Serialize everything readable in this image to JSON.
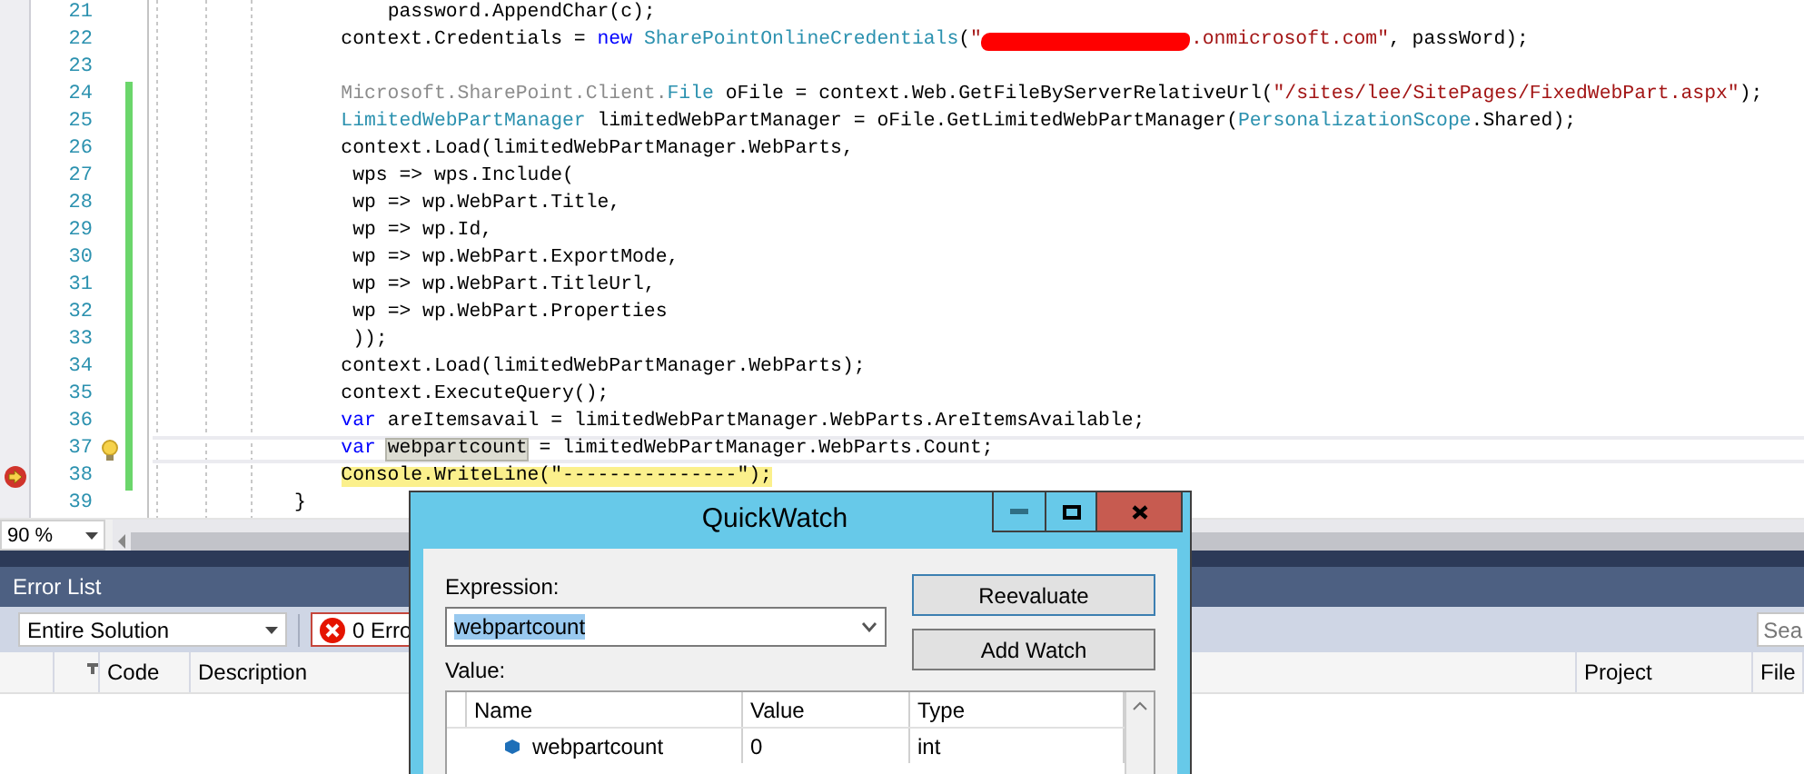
{
  "editor": {
    "lines": [
      {
        "number": "21",
        "changed": false,
        "caret_line": false,
        "lightbulb": false,
        "execution_point": false,
        "tokens": [
          {
            "kind": "plain",
            "text": "        password.AppendChar(c);"
          }
        ]
      },
      {
        "number": "22",
        "changed": false,
        "caret_line": false,
        "lightbulb": false,
        "execution_point": false,
        "tokens": [
          {
            "kind": "plain",
            "text": "    context.Credentials = "
          },
          {
            "kind": "keyword",
            "text": "new"
          },
          {
            "kind": "type",
            "text": " SharePointOnlineCredentials"
          },
          {
            "kind": "plain",
            "text": "("
          },
          {
            "kind": "string",
            "text": "\""
          },
          {
            "kind": "redaction"
          },
          {
            "kind": "string",
            "text": ".onmicrosoft.com\""
          },
          {
            "kind": "plain",
            "text": ", passWord);"
          }
        ]
      },
      {
        "number": "23",
        "changed": false,
        "caret_line": false,
        "lightbulb": false,
        "execution_point": false
      },
      {
        "number": "24",
        "changed": true,
        "caret_line": false,
        "lightbulb": false,
        "execution_point": false,
        "tokens": [
          {
            "kind": "namespace",
            "text": "    Microsoft.SharePoint.Client."
          },
          {
            "kind": "type",
            "text": "File"
          },
          {
            "kind": "plain",
            "text": " oFile = context.Web.GetFileByServerRelativeUrl("
          },
          {
            "kind": "string",
            "text": "\"/sites/lee/SitePages/FixedWebPart.aspx\""
          },
          {
            "kind": "plain",
            "text": ");"
          }
        ]
      },
      {
        "number": "25",
        "changed": true,
        "caret_line": false,
        "lightbulb": false,
        "execution_point": false,
        "tokens": [
          {
            "kind": "type",
            "text": "    LimitedWebPartManager"
          },
          {
            "kind": "plain",
            "text": " limitedWebPartManager = oFile.GetLimitedWebPartManager("
          },
          {
            "kind": "type",
            "text": "PersonalizationScope"
          },
          {
            "kind": "plain",
            "text": ".Shared);"
          }
        ]
      },
      {
        "number": "26",
        "changed": true,
        "caret_line": false,
        "lightbulb": false,
        "execution_point": false,
        "tokens": [
          {
            "kind": "plain",
            "text": "    context.Load(limitedWebPartManager.WebParts,"
          }
        ]
      },
      {
        "number": "27",
        "changed": true,
        "caret_line": false,
        "lightbulb": false,
        "execution_point": false,
        "tokens": [
          {
            "kind": "plain",
            "text": "     wps => wps.Include("
          }
        ]
      },
      {
        "number": "28",
        "changed": true,
        "caret_line": false,
        "lightbulb": false,
        "execution_point": false,
        "tokens": [
          {
            "kind": "plain",
            "text": "     wp => wp.WebPart.Title,"
          }
        ]
      },
      {
        "number": "29",
        "changed": true,
        "caret_line": false,
        "lightbulb": false,
        "execution_point": false,
        "tokens": [
          {
            "kind": "plain",
            "text": "     wp => wp.Id,"
          }
        ]
      },
      {
        "number": "30",
        "changed": true,
        "caret_line": false,
        "lightbulb": false,
        "execution_point": false,
        "tokens": [
          {
            "kind": "plain",
            "text": "     wp => wp.WebPart.ExportMode,"
          }
        ]
      },
      {
        "number": "31",
        "changed": true,
        "caret_line": false,
        "lightbulb": false,
        "execution_point": false,
        "tokens": [
          {
            "kind": "plain",
            "text": "     wp => wp.WebPart.TitleUrl,"
          }
        ]
      },
      {
        "number": "32",
        "changed": true,
        "caret_line": false,
        "lightbulb": false,
        "execution_point": false,
        "tokens": [
          {
            "kind": "plain",
            "text": "     wp => wp.WebPart.Properties"
          }
        ]
      },
      {
        "number": "33",
        "changed": true,
        "caret_line": false,
        "lightbulb": false,
        "execution_point": false,
        "tokens": [
          {
            "kind": "plain",
            "text": "     ));"
          }
        ]
      },
      {
        "number": "34",
        "changed": true,
        "caret_line": false,
        "lightbulb": false,
        "execution_point": false,
        "tokens": [
          {
            "kind": "plain",
            "text": "    context.Load(limitedWebPartManager.WebParts);"
          }
        ]
      },
      {
        "number": "35",
        "changed": true,
        "caret_line": false,
        "lightbulb": false,
        "execution_point": false,
        "tokens": [
          {
            "kind": "plain",
            "text": "    context.ExecuteQuery();"
          }
        ]
      },
      {
        "number": "36",
        "changed": true,
        "caret_line": false,
        "lightbulb": false,
        "execution_point": false,
        "tokens": [
          {
            "kind": "keyword",
            "text": "    var"
          },
          {
            "kind": "plain",
            "text": " areItemsavail = limitedWebPartManager.WebParts.AreItemsAvailable;"
          }
        ]
      },
      {
        "number": "37",
        "changed": true,
        "caret_line": true,
        "lightbulb": true,
        "execution_point": false,
        "tokens": [
          {
            "kind": "keyword",
            "text": "    var"
          },
          {
            "kind": "match",
            "text": " webpartcount"
          },
          {
            "kind": "plain",
            "text": " = limitedWebPartManager.WebParts.Count;"
          }
        ]
      },
      {
        "number": "38",
        "changed": true,
        "caret_line": false,
        "lightbulb": false,
        "execution_point": true,
        "tokens": [
          {
            "kind": "current",
            "text": "    Console.WriteLine(\"---------------\");"
          }
        ]
      },
      {
        "number": "39",
        "changed": false,
        "caret_line": false,
        "lightbulb": false,
        "execution_point": false,
        "tokens": [
          {
            "kind": "plain",
            "text": "}"
          }
        ]
      }
    ],
    "zoom": "90 %"
  },
  "error_list": {
    "title": "Error List",
    "scope": "Entire Solution",
    "errors_button": "0 Erro",
    "search": "Sea",
    "columns": [
      "Code",
      "Description",
      "Project",
      "File"
    ]
  },
  "quickwatch": {
    "title": "QuickWatch",
    "expression_label": "Expression:",
    "expression": "webpartcount",
    "value_label": "Value:",
    "buttons": [
      "Reevaluate",
      "Add Watch"
    ],
    "columns": [
      "Name",
      "Value",
      "Type"
    ],
    "rows": [
      {
        "name": "webpartcount",
        "value": "0",
        "type": "int"
      }
    ]
  }
}
